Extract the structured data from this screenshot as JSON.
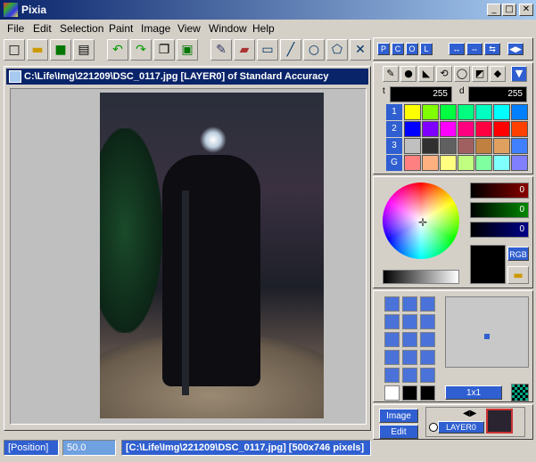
{
  "window": {
    "title": "Pixia",
    "min": "_",
    "max": "□",
    "close": "✕"
  },
  "menu": [
    "File",
    "Edit",
    "Selection",
    "Paint",
    "Image",
    "View",
    "Window",
    "Help"
  ],
  "toolbar_icons": [
    "new-icon",
    "open-icon",
    "save-icon",
    "print-icon",
    "undo-icon",
    "redo-icon",
    "copy-icon",
    "paste-icon",
    "pen-icon",
    "eraser-icon",
    "rect-icon",
    "line-icon",
    "circle-icon",
    "polygon-icon",
    "cross-icon"
  ],
  "panel_tabs": [
    "P",
    "C",
    "O",
    "L"
  ],
  "document": {
    "title": "C:\\Life\\Img\\221209\\DSC_0117.jpg [LAYER0] of Standard Accuracy"
  },
  "color": {
    "t_value": "255",
    "d_value": "255",
    "r": "0",
    "g": "0",
    "b": "0",
    "rgb_label": "RGB"
  },
  "palette_rows": [
    "1",
    "2",
    "3",
    "G"
  ],
  "palette_colors": [
    [
      "#ffff00",
      "#80ff00",
      "#00ff40",
      "#00ff80",
      "#00ffc0",
      "#00ffff",
      "#0080ff"
    ],
    [
      "#0000ff",
      "#8000ff",
      "#ff00ff",
      "#ff0080",
      "#ff0040",
      "#ff0000",
      "#ff4000"
    ],
    [
      "#c0c0c0",
      "#303030",
      "#606060",
      "#a06060",
      "#c08040",
      "#e0a060",
      "#4080ff"
    ],
    [
      "#ff8080",
      "#ffb080",
      "#ffff80",
      "#c0ff80",
      "#80ffa0",
      "#80ffff",
      "#8080ff"
    ]
  ],
  "brush": {
    "size_label": "1x1"
  },
  "layers": {
    "image_btn": "Image",
    "edit_btn": "Edit",
    "layer_name": "LAYER0"
  },
  "status": {
    "position": "[Position]",
    "zoom": "50.0",
    "file": "[C:\\Life\\Img\\221209\\DSC_0117.jpg] [500x746 pixels]"
  }
}
